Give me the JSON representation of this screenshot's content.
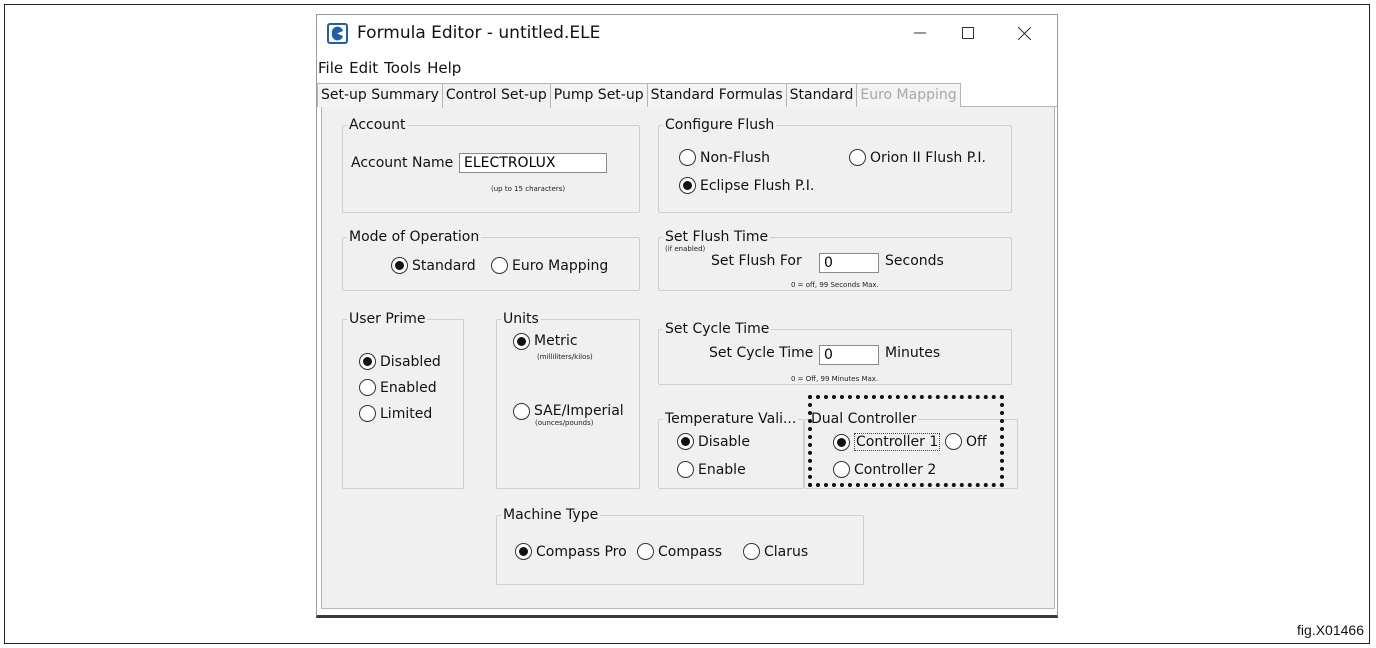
{
  "window": {
    "title": "Formula Editor - untitled.ELE"
  },
  "menu": [
    "File",
    "Edit",
    "Tools",
    "Help"
  ],
  "tabs": [
    {
      "label": "Set-up Summary"
    },
    {
      "label": "Control Set-up"
    },
    {
      "label": "Pump Set-up"
    },
    {
      "label": "Standard Formulas"
    },
    {
      "label": "Standard"
    },
    {
      "label": "Euro Mapping"
    }
  ],
  "account": {
    "legend": "Account",
    "name_label": "Account Name",
    "name_value": "ELECTROLUX",
    "hint": "(up to 15 characters)"
  },
  "flush": {
    "legend": "Configure Flush",
    "non_flush": "Non-Flush",
    "orion": "Orion II Flush P.I.",
    "eclipse": "Eclipse Flush P.I.",
    "selected": "Eclipse Flush P.I."
  },
  "mode": {
    "legend": "Mode of Operation",
    "standard": "Standard",
    "euro": "Euro Mapping",
    "selected": "Standard"
  },
  "flush_time": {
    "legend": "Set Flush Time",
    "note": "(if enabled)",
    "label": "Set Flush For",
    "value": "0",
    "unit": "Seconds",
    "hint": "0 = off, 99 Seconds Max."
  },
  "user_prime": {
    "legend": "User Prime",
    "disabled": "Disabled",
    "enabled": "Enabled",
    "limited": "Limited",
    "selected": "Disabled"
  },
  "units": {
    "legend": "Units",
    "metric": "Metric",
    "metric_sub": "(milliliters/kilos)",
    "sae": "SAE/Imperial",
    "sae_sub": "(ounces/pounds)",
    "selected": "Metric"
  },
  "cycle_time": {
    "legend": "Set Cycle Time",
    "label": "Set Cycle Time",
    "value": "0",
    "unit": "Minutes",
    "hint": "0 = Off, 99 Minutes Max."
  },
  "temperature": {
    "legend": "Temperature Vali...",
    "disable": "Disable",
    "enable": "Enable",
    "selected": "Disable"
  },
  "dual": {
    "legend": "Dual Controller",
    "c1": "Controller 1",
    "off": "Off",
    "c2": "Controller 2",
    "selected": "Controller 1"
  },
  "machine": {
    "legend": "Machine Type",
    "compass_pro": "Compass Pro",
    "compass": "Compass",
    "clarus": "Clarus",
    "selected": "Compass Pro"
  },
  "figure_label": "fig.X01466",
  "colors": {
    "panel": "#f0f0f0",
    "icon_blue": "#1f5fa8",
    "disabled_text": "#a8a8a8"
  }
}
